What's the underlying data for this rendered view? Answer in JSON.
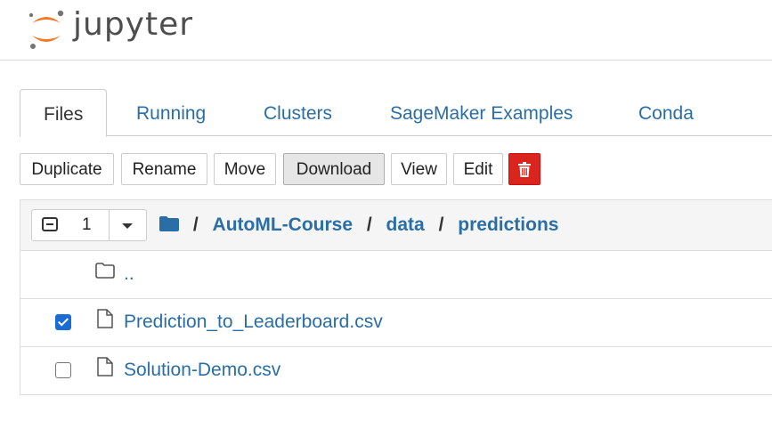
{
  "header": {
    "app_name": "jupyter",
    "logo_icon": "jupyter-logo-icon"
  },
  "tabs": [
    {
      "label": "Files",
      "active": true
    },
    {
      "label": "Running",
      "active": false
    },
    {
      "label": "Clusters",
      "active": false
    },
    {
      "label": "SageMaker Examples",
      "active": false
    },
    {
      "label": "Conda",
      "active": false
    }
  ],
  "toolbar": {
    "duplicate": "Duplicate",
    "rename": "Rename",
    "move": "Move",
    "download": "Download",
    "view": "View",
    "edit": "Edit",
    "delete_icon": "trash-icon"
  },
  "selection": {
    "count": "1"
  },
  "breadcrumb": {
    "root_icon": "folder-icon",
    "separator": "/",
    "items": [
      "AutoML-Course",
      "data",
      "predictions"
    ]
  },
  "files": [
    {
      "name": "..",
      "type": "folder",
      "checked": false
    },
    {
      "name": "Prediction_to_Leaderboard.csv",
      "type": "file",
      "checked": true
    },
    {
      "name": "Solution-Demo.csv",
      "type": "file",
      "checked": false
    }
  ],
  "colors": {
    "link": "#2a6ea6",
    "danger": "#d9251d",
    "checkbox": "#1a6cd4",
    "logo_orange": "#f37726"
  }
}
